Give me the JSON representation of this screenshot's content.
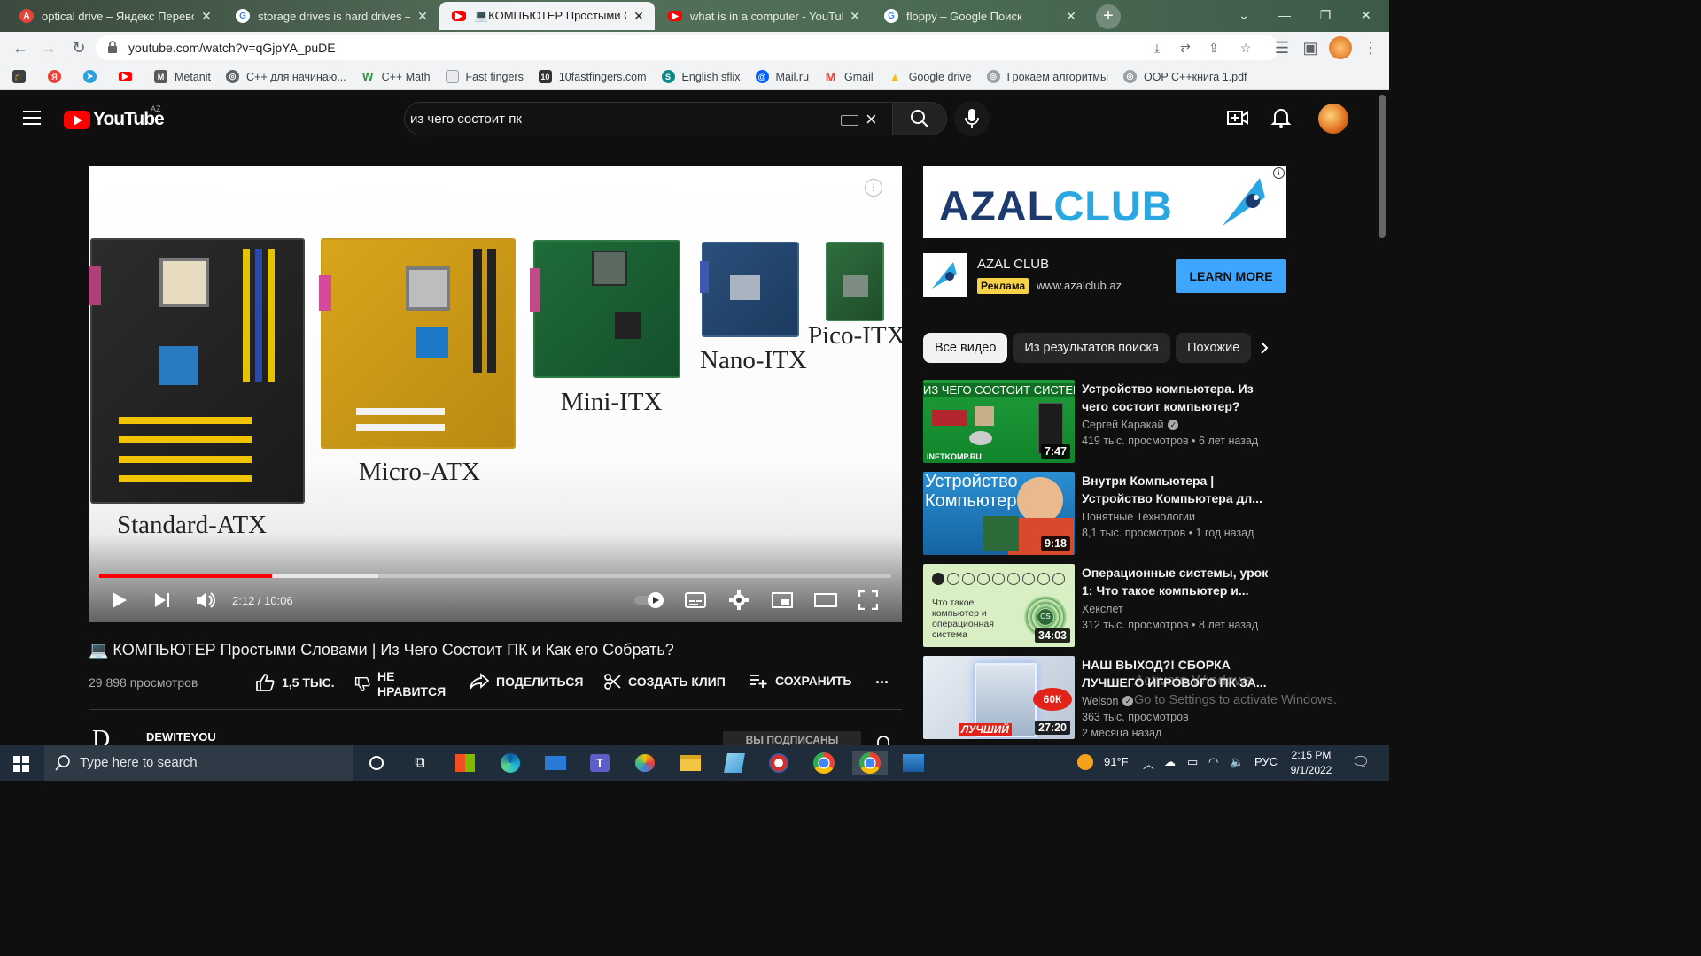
{
  "browser": {
    "tabs": [
      {
        "title": "optical drive – Яндекс Переводчик",
        "favicon": "yandex-translate-icon",
        "color": "#e8433a"
      },
      {
        "title": "storage drives is hard drives – Google Поиск",
        "favicon": "google-icon",
        "color": "#ffffff"
      },
      {
        "title": "💻КОМПЬЮТЕР Простыми Словами",
        "favicon": "youtube-icon",
        "color": "#ff0000"
      },
      {
        "title": "what is in a computer - YouTube",
        "favicon": "youtube-icon",
        "color": "#ff0000"
      },
      {
        "title": "floppy – Google Поиск",
        "favicon": "google-icon",
        "color": "#ffffff"
      }
    ],
    "active_tab": 2,
    "url": "youtube.com/watch?v=qGjpYA_puDE",
    "bookmarks": [
      {
        "label": "",
        "icon": "graduation-cap-icon",
        "color": "#3c4043"
      },
      {
        "label": "",
        "icon": "yandex-icon",
        "color": "#e8433a"
      },
      {
        "label": "",
        "icon": "telegram-icon",
        "color": "#2aa1da"
      },
      {
        "label": "",
        "icon": "youtube-icon",
        "color": "#ff0000"
      },
      {
        "label": "Metanit",
        "icon": "metanit-icon",
        "color": "#5a5a5a"
      },
      {
        "label": "C++ для начинаю...",
        "icon": "globe-icon",
        "color": "#5f6368"
      },
      {
        "label": "C++ Math",
        "icon": "w-icon",
        "color": "#2f8f3a"
      },
      {
        "label": "Fast fingers",
        "icon": "page-icon",
        "color": "#9aa0a6"
      },
      {
        "label": "10fastfingers.com",
        "icon": "10ff-icon",
        "color": "#333333"
      },
      {
        "label": "English sflix",
        "icon": "sflix-icon",
        "color": "#0b8a8a"
      },
      {
        "label": "Mail.ru",
        "icon": "mailru-icon",
        "color": "#005ff9"
      },
      {
        "label": "Gmail",
        "icon": "gmail-icon",
        "color": "#ea4335"
      },
      {
        "label": "Google drive",
        "icon": "google-drive-icon",
        "color": "#fbbc04"
      },
      {
        "label": "Грокаем алгоритмы",
        "icon": "globe-icon",
        "color": "#9aa0a6"
      },
      {
        "label": "OOP C++книга 1.pdf",
        "icon": "globe-icon",
        "color": "#9aa0a6"
      }
    ]
  },
  "youtube": {
    "logo_text": "YouTube",
    "country_code": "AZ",
    "search_query": "из чего состоит пк",
    "player": {
      "boards": [
        "Standard-ATX",
        "Micro-ATX",
        "Mini-ITX",
        "Nano-ITX",
        "Pico-ITX"
      ],
      "time_display": "2:12 / 10:06",
      "played_fraction": 0.218,
      "buffered_fraction": 0.352
    },
    "video": {
      "title": "💻 КОМПЬЮТЕР Простыми Словами | Из Чего Состоит ПК и Как его Собрать?",
      "views": "29 898 просмотров",
      "likes": "1,5 ТЫС.",
      "dislike_label": "НЕ НРАВИТСЯ",
      "share_label": "ПОДЕЛИТЬСЯ",
      "clip_label": "СОЗДАТЬ КЛИП",
      "save_label": "СОХРАНИТЬ",
      "more": "...",
      "channel_logo": "D",
      "channel": "DEWITEYOU",
      "subscribed_label": "ВЫ ПОДПИСАНЫ"
    },
    "ad": {
      "banner_left": "AZAL",
      "banner_right": "CLUB",
      "title": "AZAL CLUB",
      "badge": "Реклама",
      "url": "www.azalclub.az",
      "cta": "LEARN MORE",
      "colors": {
        "dark": "#1c3a6e",
        "light": "#2aa6e0"
      }
    },
    "chips": [
      "Все видео",
      "Из результатов поиска",
      "Похожие"
    ],
    "recommendations": [
      {
        "title": "Устройство компьютера. Из чего состоит компьютер?",
        "channel": "Сергей Каракай",
        "verified": true,
        "meta": "419 тыс. просмотров • 6 лет назад",
        "duration": "7:47",
        "thumb_text": "ИЗ ЧЕГО СОСТОИТ СИСТЕМНИК",
        "thumb_sub": "INETKOMP.RU"
      },
      {
        "title": "Внутри Компьютера | Устройство Компьютера дл...",
        "channel": "Понятные Технологии",
        "verified": false,
        "meta": "8,1 тыс. просмотров • 1 год назад",
        "duration": "9:18",
        "thumb_text": "Устройство Компьютера",
        "thumb_sub": ""
      },
      {
        "title": "Операционные системы, урок 1: Что такое компьютер и...",
        "channel": "Хекслет",
        "verified": false,
        "meta": "312 тыс. просмотров • 8 лет назад",
        "duration": "34:03",
        "thumb_text": "Что такое компьютер и операционная система",
        "thumb_sub": "OS"
      },
      {
        "title": "НАШ ВЫХОД?! СБОРКА ЛУЧШЕГО ИГРОВОГО ПК ЗА...",
        "channel": "Welson",
        "verified": true,
        "meta": "363 тыс. просмотров",
        "meta2": "2 месяца назад",
        "duration": "27:20",
        "thumb_text": "ЛУЧШИЙ",
        "thumb_sub": "60К"
      }
    ]
  },
  "watermark": {
    "line1": "Activate Windows",
    "line2": "Go to Settings to activate Windows."
  },
  "taskbar": {
    "search_placeholder": "Type here to search",
    "weather": "91°F",
    "language": "РУС",
    "time": "2:15 PM",
    "date": "9/1/2022"
  }
}
